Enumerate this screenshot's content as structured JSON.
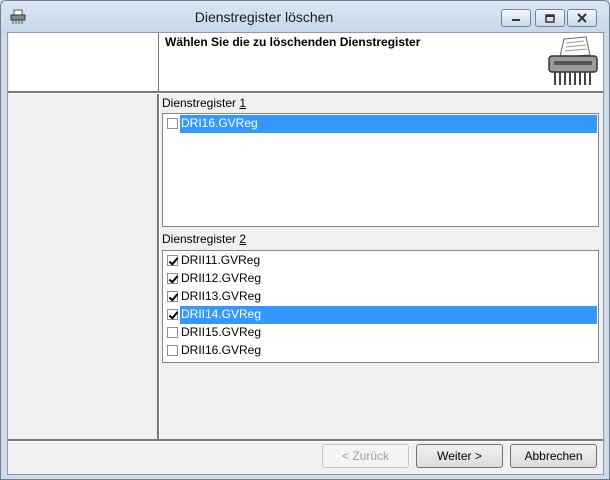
{
  "window": {
    "title": "Dienstregister löschen",
    "controls": [
      "minimize-icon",
      "maximize-icon",
      "close-icon"
    ]
  },
  "header": {
    "title": "Wählen Sie die zu löschenden Dienstregister",
    "icon": "shredder-icon"
  },
  "list1": {
    "label_text": "Dienstregister ",
    "label_key": "1",
    "items": [
      {
        "label": "DRI16.GVReg",
        "checked": false,
        "selected": true
      }
    ]
  },
  "list2": {
    "label_text": "Dienstregister ",
    "label_key": "2",
    "items": [
      {
        "label": "DRII11.GVReg",
        "checked": true,
        "selected": false
      },
      {
        "label": "DRII12.GVReg",
        "checked": true,
        "selected": false
      },
      {
        "label": "DRII13.GVReg",
        "checked": true,
        "selected": false
      },
      {
        "label": "DRII14.GVReg",
        "checked": true,
        "selected": true
      },
      {
        "label": "DRII15.GVReg",
        "checked": false,
        "selected": false
      },
      {
        "label": "DRII16.GVReg",
        "checked": false,
        "selected": false
      }
    ]
  },
  "buttons": {
    "back": "< Zurück",
    "back_enabled": false,
    "next": "Weiter >",
    "cancel": "Abbrechen"
  },
  "colors": {
    "selection": "#3399ff",
    "titlebar": "#cfdbe8",
    "dialog_bg": "#f0f0f0"
  }
}
